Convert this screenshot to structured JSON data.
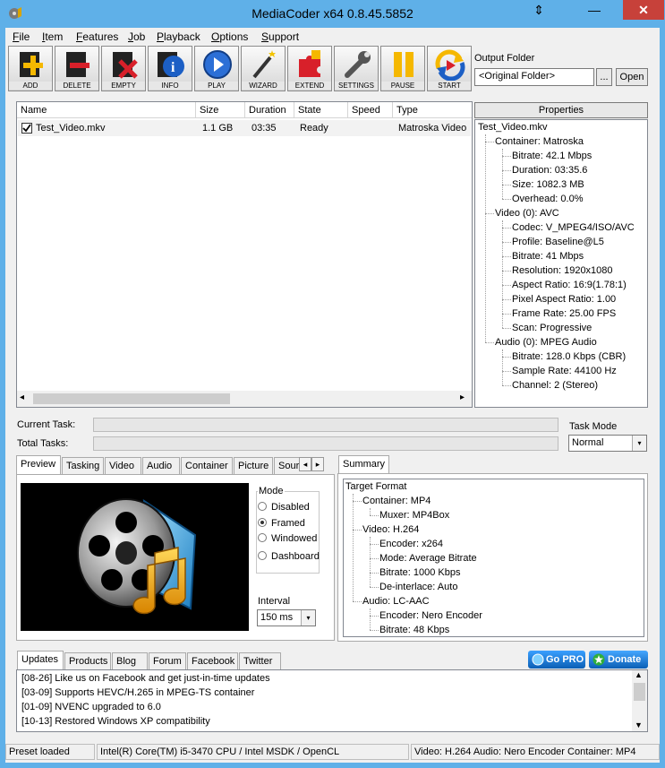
{
  "window": {
    "title": "MediaCoder x64 0.8.45.5852",
    "restore_glyph": "⇕",
    "min_glyph": "—",
    "close_glyph": "✕"
  },
  "menu": [
    {
      "label": "File",
      "key": "F",
      "rest": "ile"
    },
    {
      "label": "Item",
      "key": "I",
      "rest": "tem"
    },
    {
      "label": "Features",
      "key": "F",
      "rest": "eatures"
    },
    {
      "label": "Job",
      "key": "J",
      "rest": "ob"
    },
    {
      "label": "Playback",
      "key": "P",
      "rest": "layback"
    },
    {
      "label": "Options",
      "key": "O",
      "rest": "ptions"
    },
    {
      "label": "Support",
      "key": "S",
      "rest": "upport"
    }
  ],
  "toolbar": {
    "add": "ADD",
    "delete": "DELETE",
    "empty": "EMPTY",
    "info": "INFO",
    "play": "PLAY",
    "wizard": "WIZARD",
    "extend": "EXTEND",
    "settings": "SETTINGS",
    "pause": "PAUSE",
    "start": "START"
  },
  "output_folder": {
    "label": "Output Folder",
    "value": "<Original Folder>",
    "browse": "...",
    "open": "Open"
  },
  "filelist": {
    "columns": [
      "Name",
      "Size",
      "Duration",
      "State",
      "Speed",
      "Type"
    ],
    "rows": [
      {
        "name": "Test_Video.mkv",
        "size": "1.1 GB",
        "duration": "03:35",
        "state": "Ready",
        "speed": "",
        "type": "Matroska Video",
        "checked": true
      }
    ],
    "scroll_left": "◂",
    "scroll_right": "▸"
  },
  "properties": {
    "header": "Properties",
    "root": "Test_Video.mkv",
    "container": "Container: Matroska",
    "container_items": [
      "Bitrate: 42.1 Mbps",
      "Duration: 03:35.6",
      "Size: 1082.3 MB",
      "Overhead: 0.0%"
    ],
    "video": "Video (0): AVC",
    "video_items": [
      "Codec: V_MPEG4/ISO/AVC",
      "Profile: Baseline@L5",
      "Bitrate: 41 Mbps",
      "Resolution: 1920x1080",
      "Aspect Ratio: 16:9(1.78:1)",
      "Pixel Aspect Ratio: 1.00",
      "Frame Rate: 25.00 FPS",
      "Scan: Progressive"
    ],
    "audio": "Audio (0): MPEG Audio",
    "audio_items": [
      "Bitrate: 128.0 Kbps (CBR)",
      "Sample Rate: 44100 Hz",
      "Channel: 2 (Stereo)"
    ]
  },
  "tasks": {
    "current_label": "Current Task:",
    "total_label": "Total Tasks:",
    "mode_label": "Task Mode",
    "mode_value": "Normal",
    "dropdown_glyph": "▾"
  },
  "left_tabs": [
    "Preview",
    "Tasking",
    "Video",
    "Audio",
    "Container",
    "Picture",
    "Sour"
  ],
  "tab_scroll": {
    "left": "◂",
    "right": "▸"
  },
  "preview": {
    "mode_label": "Mode",
    "modes": [
      "Disabled",
      "Framed",
      "Windowed",
      "Dashboard"
    ],
    "selected_mode": "Framed",
    "interval_label": "Interval",
    "interval_value": "150 ms"
  },
  "summary": {
    "tab": "Summary",
    "root": "Target Format",
    "container": "Container: MP4",
    "container_items": [
      "Muxer: MP4Box"
    ],
    "video": "Video: H.264",
    "video_items": [
      "Encoder: x264",
      "Mode: Average Bitrate",
      "Bitrate: 1000 Kbps",
      "De-interlace: Auto"
    ],
    "audio": "Audio: LC-AAC",
    "audio_items": [
      "Encoder: Nero Encoder",
      "Bitrate: 48 Kbps"
    ]
  },
  "bottom_tabs": [
    "Updates",
    "Products",
    "Blog",
    "Forum",
    "Facebook",
    "Twitter"
  ],
  "buttons": {
    "gopro": "Go PRO",
    "donate": "Donate"
  },
  "updates": [
    "[08-26] Like us on Facebook and get just-in-time updates",
    "[03-09] Supports HEVC/H.265 in MPEG-TS container",
    "[01-09] NVENC upgraded to 6.0",
    "[10-13] Restored Windows XP compatibility"
  ],
  "status": {
    "left": "Preset loaded",
    "middle": "Intel(R) Core(TM) i5-3470 CPU  / Intel MSDK / OpenCL",
    "right": "Video: H.264  Audio: Nero Encoder  Container: MP4"
  },
  "colors": {
    "title_bar": "#5fb0e8",
    "close": "#c7413a",
    "accent": "#0b5fb5"
  }
}
